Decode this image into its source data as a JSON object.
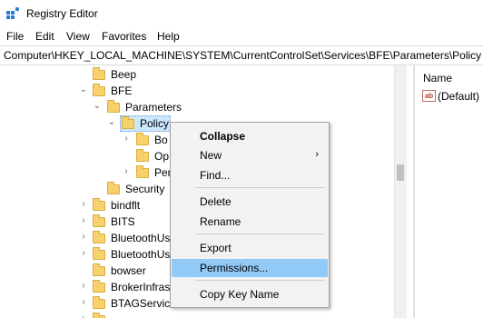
{
  "window": {
    "title": "Registry Editor"
  },
  "menu": [
    "File",
    "Edit",
    "View",
    "Favorites",
    "Help"
  ],
  "address": "Computer\\HKEY_LOCAL_MACHINE\\SYSTEM\\CurrentControlSet\\Services\\BFE\\Parameters\\Policy",
  "tree": {
    "beep": "Beep",
    "bfe": "BFE",
    "parameters": "Parameters",
    "policy": "Policy",
    "bo": "Bo",
    "op": "Op",
    "per": "Per",
    "security": "Security",
    "bindflt": "bindflt",
    "bits": "BITS",
    "bluetoothus1": "BluetoothUs",
    "bluetoothus2": "BluetoothUs",
    "bowser": "bowser",
    "brokerinfras": "BrokerInfras",
    "btagservice": "BTAGService"
  },
  "right_pane": {
    "column_name": "Name",
    "value_name": "(Default)",
    "value_icon_text": "ab"
  },
  "context_menu": {
    "collapse": "Collapse",
    "new": "New",
    "find": "Find...",
    "delete": "Delete",
    "rename": "Rename",
    "export": "Export",
    "permissions": "Permissions...",
    "copy_key_name": "Copy Key Name",
    "submenu_arrow": "›"
  },
  "colors": {
    "selection": "#cce8ff",
    "menu_highlight": "#91c9f7",
    "folder": "#f7d26a"
  }
}
